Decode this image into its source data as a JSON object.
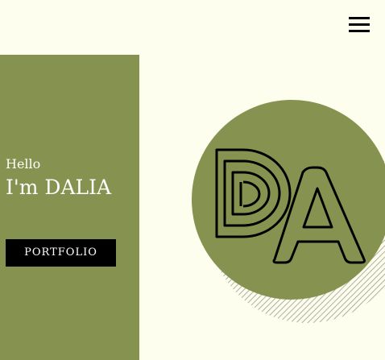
{
  "header": {
    "menu_icon": "hamburger-menu-icon"
  },
  "hero": {
    "greeting": "Hello",
    "name": "I'm DALIA",
    "cta_label": "PORTFOLIO"
  },
  "logo": {
    "monogram": "DA",
    "icon": "da-monogram-logo"
  },
  "colors": {
    "background": "#fefeee",
    "accent_green": "#86924f",
    "button_bg": "#000000",
    "text_light": "#ffffff"
  }
}
